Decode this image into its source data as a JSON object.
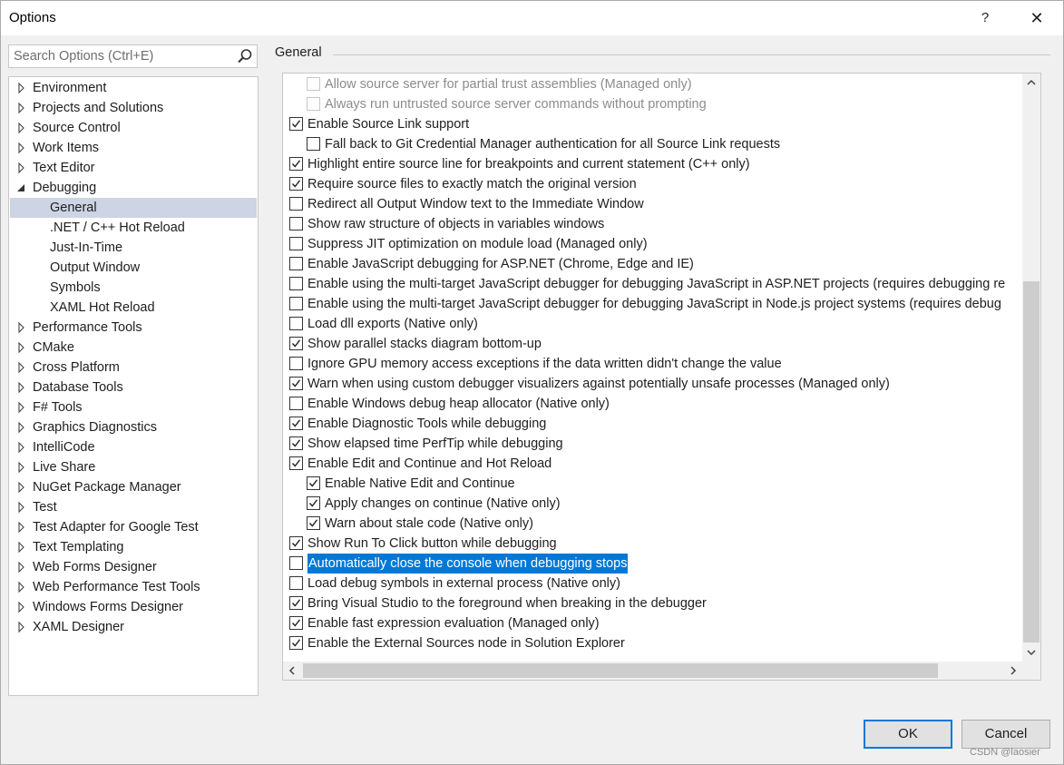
{
  "window": {
    "title": "Options",
    "help_label": "?",
    "close_label": "✕"
  },
  "search": {
    "placeholder": "Search Options (Ctrl+E)"
  },
  "tree": {
    "items": [
      {
        "label": "Environment",
        "expanded": false,
        "level": 0
      },
      {
        "label": "Projects and Solutions",
        "expanded": false,
        "level": 0
      },
      {
        "label": "Source Control",
        "expanded": false,
        "level": 0
      },
      {
        "label": "Work Items",
        "expanded": false,
        "level": 0
      },
      {
        "label": "Text Editor",
        "expanded": false,
        "level": 0
      },
      {
        "label": "Debugging",
        "expanded": true,
        "level": 0
      },
      {
        "label": "General",
        "level": 1,
        "selected": true
      },
      {
        "label": ".NET / C++ Hot Reload",
        "level": 1
      },
      {
        "label": "Just-In-Time",
        "level": 1
      },
      {
        "label": "Output Window",
        "level": 1
      },
      {
        "label": "Symbols",
        "level": 1
      },
      {
        "label": "XAML Hot Reload",
        "level": 1
      },
      {
        "label": "Performance Tools",
        "expanded": false,
        "level": 0
      },
      {
        "label": "CMake",
        "expanded": false,
        "level": 0
      },
      {
        "label": "Cross Platform",
        "expanded": false,
        "level": 0
      },
      {
        "label": "Database Tools",
        "expanded": false,
        "level": 0
      },
      {
        "label": "F# Tools",
        "expanded": false,
        "level": 0
      },
      {
        "label": "Graphics Diagnostics",
        "expanded": false,
        "level": 0
      },
      {
        "label": "IntelliCode",
        "expanded": false,
        "level": 0
      },
      {
        "label": "Live Share",
        "expanded": false,
        "level": 0
      },
      {
        "label": "NuGet Package Manager",
        "expanded": false,
        "level": 0
      },
      {
        "label": "Test",
        "expanded": false,
        "level": 0
      },
      {
        "label": "Test Adapter for Google Test",
        "expanded": false,
        "level": 0
      },
      {
        "label": "Text Templating",
        "expanded": false,
        "level": 0
      },
      {
        "label": "Web Forms Designer",
        "expanded": false,
        "level": 0
      },
      {
        "label": "Web Performance Test Tools",
        "expanded": false,
        "level": 0
      },
      {
        "label": "Windows Forms Designer",
        "expanded": false,
        "level": 0
      },
      {
        "label": "XAML Designer",
        "expanded": false,
        "level": 0
      }
    ]
  },
  "section": {
    "title": "General"
  },
  "options": [
    {
      "label": "Allow source server for partial trust assemblies (Managed only)",
      "checked": false,
      "disabled": true,
      "indent": 1
    },
    {
      "label": "Always run untrusted source server commands without prompting",
      "checked": false,
      "disabled": true,
      "indent": 1
    },
    {
      "label": "Enable Source Link support",
      "checked": true,
      "indent": 0
    },
    {
      "label": "Fall back to Git Credential Manager authentication for all Source Link requests",
      "checked": false,
      "indent": 1
    },
    {
      "label": "Highlight entire source line for breakpoints and current statement (C++ only)",
      "checked": true,
      "indent": 0
    },
    {
      "label": "Require source files to exactly match the original version",
      "checked": true,
      "indent": 0
    },
    {
      "label": "Redirect all Output Window text to the Immediate Window",
      "checked": false,
      "indent": 0
    },
    {
      "label": "Show raw structure of objects in variables windows",
      "checked": false,
      "indent": 0
    },
    {
      "label": "Suppress JIT optimization on module load (Managed only)",
      "checked": false,
      "indent": 0
    },
    {
      "label": "Enable JavaScript debugging for ASP.NET (Chrome, Edge and IE)",
      "checked": false,
      "indent": 0
    },
    {
      "label": "Enable using the multi-target JavaScript debugger for debugging JavaScript in ASP.NET projects (requires debugging re",
      "checked": false,
      "indent": 0
    },
    {
      "label": "Enable using the multi-target JavaScript debugger for debugging JavaScript in Node.js project systems (requires debug",
      "checked": false,
      "indent": 0
    },
    {
      "label": "Load dll exports (Native only)",
      "checked": false,
      "indent": 0
    },
    {
      "label": "Show parallel stacks diagram bottom-up",
      "checked": true,
      "indent": 0
    },
    {
      "label": "Ignore GPU memory access exceptions if the data written didn't change the value",
      "checked": false,
      "indent": 0
    },
    {
      "label": "Warn when using custom debugger visualizers against potentially unsafe processes (Managed only)",
      "checked": true,
      "indent": 0
    },
    {
      "label": "Enable Windows debug heap allocator (Native only)",
      "checked": false,
      "indent": 0
    },
    {
      "label": "Enable Diagnostic Tools while debugging",
      "checked": true,
      "indent": 0
    },
    {
      "label": "Show elapsed time PerfTip while debugging",
      "checked": true,
      "indent": 0
    },
    {
      "label": "Enable Edit and Continue and Hot Reload",
      "checked": true,
      "indent": 0
    },
    {
      "label": "Enable Native Edit and Continue",
      "checked": true,
      "indent": 1
    },
    {
      "label": "Apply changes on continue (Native only)",
      "checked": true,
      "indent": 1
    },
    {
      "label": "Warn about stale code (Native only)",
      "checked": true,
      "indent": 1
    },
    {
      "label": "Show Run To Click button while debugging",
      "checked": true,
      "indent": 0
    },
    {
      "label": "Automatically close the console when debugging stops",
      "checked": false,
      "indent": 0,
      "highlighted": true
    },
    {
      "label": "Load debug symbols in external process (Native only)",
      "checked": false,
      "indent": 0
    },
    {
      "label": "Bring Visual Studio to the foreground when breaking in the debugger",
      "checked": true,
      "indent": 0
    },
    {
      "label": "Enable fast expression evaluation (Managed only)",
      "checked": true,
      "indent": 0
    },
    {
      "label": "Enable the External Sources node in Solution Explorer",
      "checked": true,
      "indent": 0
    }
  ],
  "buttons": {
    "ok": "OK",
    "cancel": "Cancel"
  },
  "watermark": "CSDN @laosier",
  "colors": {
    "selection": "#0078d7",
    "tree_selected": "#cdd4e3",
    "default_button_border": "#0078d7"
  }
}
